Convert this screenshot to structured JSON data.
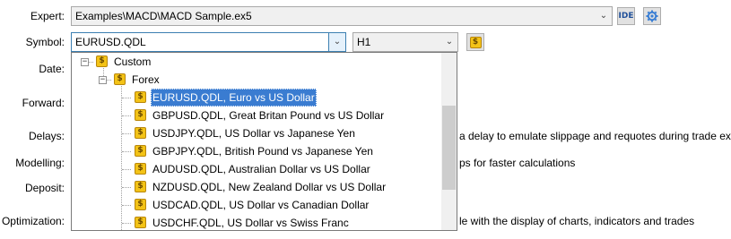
{
  "form": {
    "expert_label": "Expert:",
    "expert_value": "Examples\\MACD\\MACD Sample.ex5",
    "ide_label": "IDE",
    "symbol_label": "Symbol:",
    "symbol_value": "EURUSD.QDL",
    "period_value": "H1",
    "date_label": "Date:",
    "forward_label": "Forward:",
    "delays_label": "Delays:",
    "delays_text": "a delay to emulate slippage and requotes during trade execution",
    "modelling_label": "Modelling:",
    "modelling_text": "ps for faster calculations",
    "deposit_label": "Deposit:",
    "optimization_label": "Optimization:",
    "optimization_text": "le with the display of charts, indicators and trades"
  },
  "symbol_tree": {
    "groups": [
      {
        "label": "Custom",
        "expander": "−"
      },
      {
        "label": "Forex",
        "expander": "−"
      }
    ],
    "coin_glyph": "$",
    "items": [
      {
        "label": "EURUSD.QDL, Euro vs US Dollar",
        "selected": true
      },
      {
        "label": "GBPUSD.QDL, Great Britan Pound vs US Dollar",
        "selected": false
      },
      {
        "label": "USDJPY.QDL, US Dollar vs Japanese Yen",
        "selected": false
      },
      {
        "label": "GBPJPY.QDL, British Pound vs Japanese Yen",
        "selected": false
      },
      {
        "label": "AUDUSD.QDL, Australian Dollar vs US Dollar",
        "selected": false
      },
      {
        "label": "NZDUSD.QDL, New Zealand Dollar vs US Dollar",
        "selected": false
      },
      {
        "label": "USDCAD.QDL, US Dollar vs Canadian Dollar",
        "selected": false
      },
      {
        "label": "USDCHF.QDL, US Dollar vs Swiss Franc",
        "selected": false
      }
    ]
  },
  "colors": {
    "selection": "#3a7cd1",
    "coin": "#f3c317",
    "gear": "#3b7fd4"
  },
  "icons": [
    "settings-gear-icon",
    "dollar-coin-icon",
    "chevron-down-icon",
    "tree-collapse-icon"
  ]
}
